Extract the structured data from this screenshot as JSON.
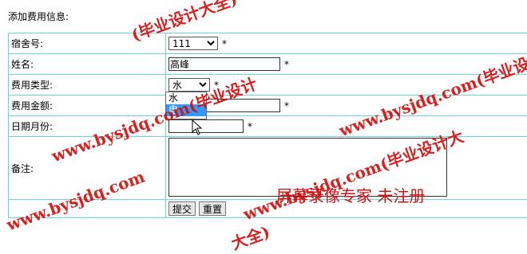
{
  "page": {
    "title": "添加费用信息:"
  },
  "form": {
    "dorm_label": "宿舍号:",
    "dorm_value": "111",
    "name_label": "姓名:",
    "name_value": "高峰",
    "fee_type_label": "费用类型:",
    "fee_type_value": "水",
    "fee_type_options": [
      "水",
      "电"
    ],
    "amount_label": "费用金额:",
    "amount_value": "",
    "date_label": "日期月份:",
    "date_value": "",
    "remark_label": "备注:",
    "required_mark": "*",
    "submit_label": "提交",
    "reset_label": "重置"
  },
  "watermarks": {
    "site": "www.bysjdq.com(毕业设计大全)",
    "site_fragments": [
      "(毕业设计大全)",
      "www.bysjdq.com(毕业设计",
      "www.bysjdq.com(毕业设计",
      "www.bysjdq.com",
      "www.bysjdq.com(毕业设计大",
      "大全)"
    ],
    "recorder": "屏幕录像专家 未注册"
  },
  "colors": {
    "grid_border": "#6fd3d8",
    "highlight": "#3399ff",
    "watermark": "#d01010"
  }
}
